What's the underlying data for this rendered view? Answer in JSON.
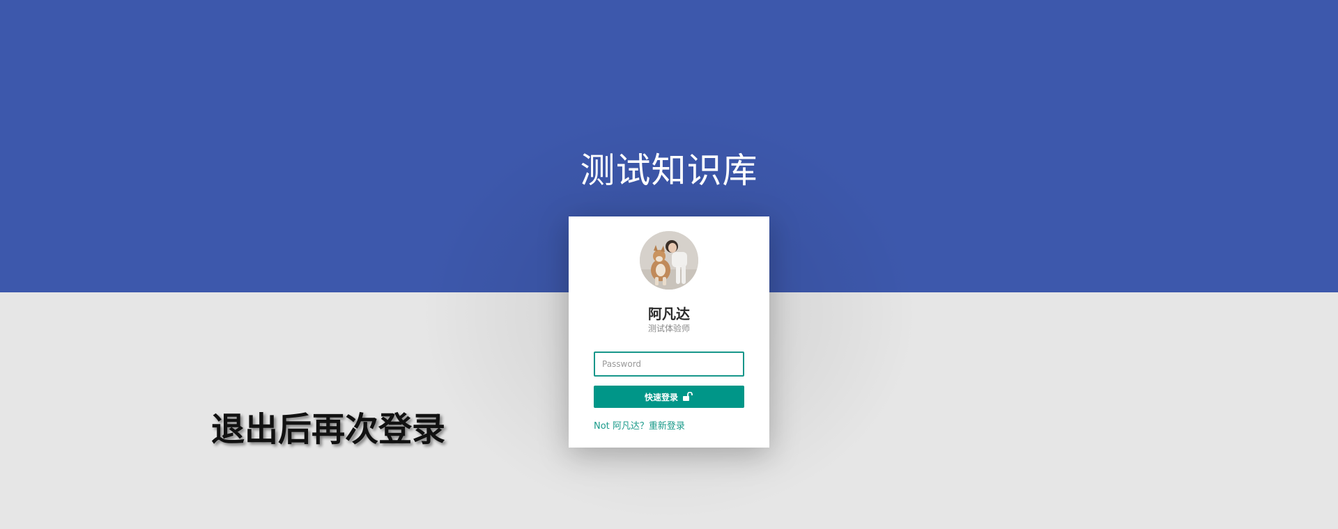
{
  "page": {
    "site_title": "测试知识库",
    "caption": "退出后再次登录"
  },
  "colors": {
    "header_background": "#3d58ac",
    "page_background": "#e6e6e6",
    "accent": "#009688"
  },
  "login_card": {
    "user_name": "阿凡达",
    "user_role": "测试体验师",
    "password_placeholder": "Password",
    "login_button_label": "快速登录",
    "login_button_icon": "unlock-icon",
    "switch_user_prefix": "Not 阿凡达？",
    "switch_user_link": "重新登录"
  }
}
